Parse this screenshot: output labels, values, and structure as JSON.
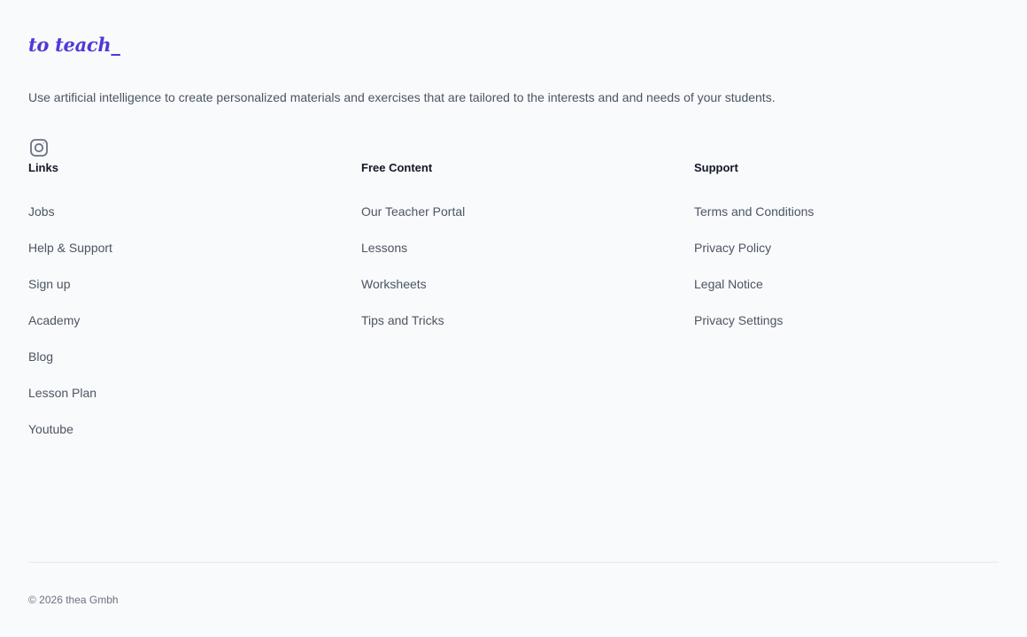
{
  "brand": {
    "logo_text": "to teach_",
    "tagline": "Use artificial intelligence to create personalized materials and exercises that are tailored to the interests and and needs of your students.",
    "accent_color": "#4c3ad9"
  },
  "social": {
    "icon": "instagram-icon"
  },
  "columns": [
    {
      "heading": "Links",
      "items": [
        "Jobs",
        "Help & Support",
        "Sign up",
        "Academy",
        "Blog",
        "Lesson Plan",
        "Youtube"
      ]
    },
    {
      "heading": "Free Content",
      "items": [
        "Our Teacher Portal",
        "Lessons",
        "Worksheets",
        "Tips and Tricks"
      ]
    },
    {
      "heading": "Support",
      "items": [
        "Terms and Conditions",
        "Privacy Policy",
        "Legal Notice",
        "Privacy Settings"
      ]
    }
  ],
  "copyright": "© 2026 thea Gmbh"
}
